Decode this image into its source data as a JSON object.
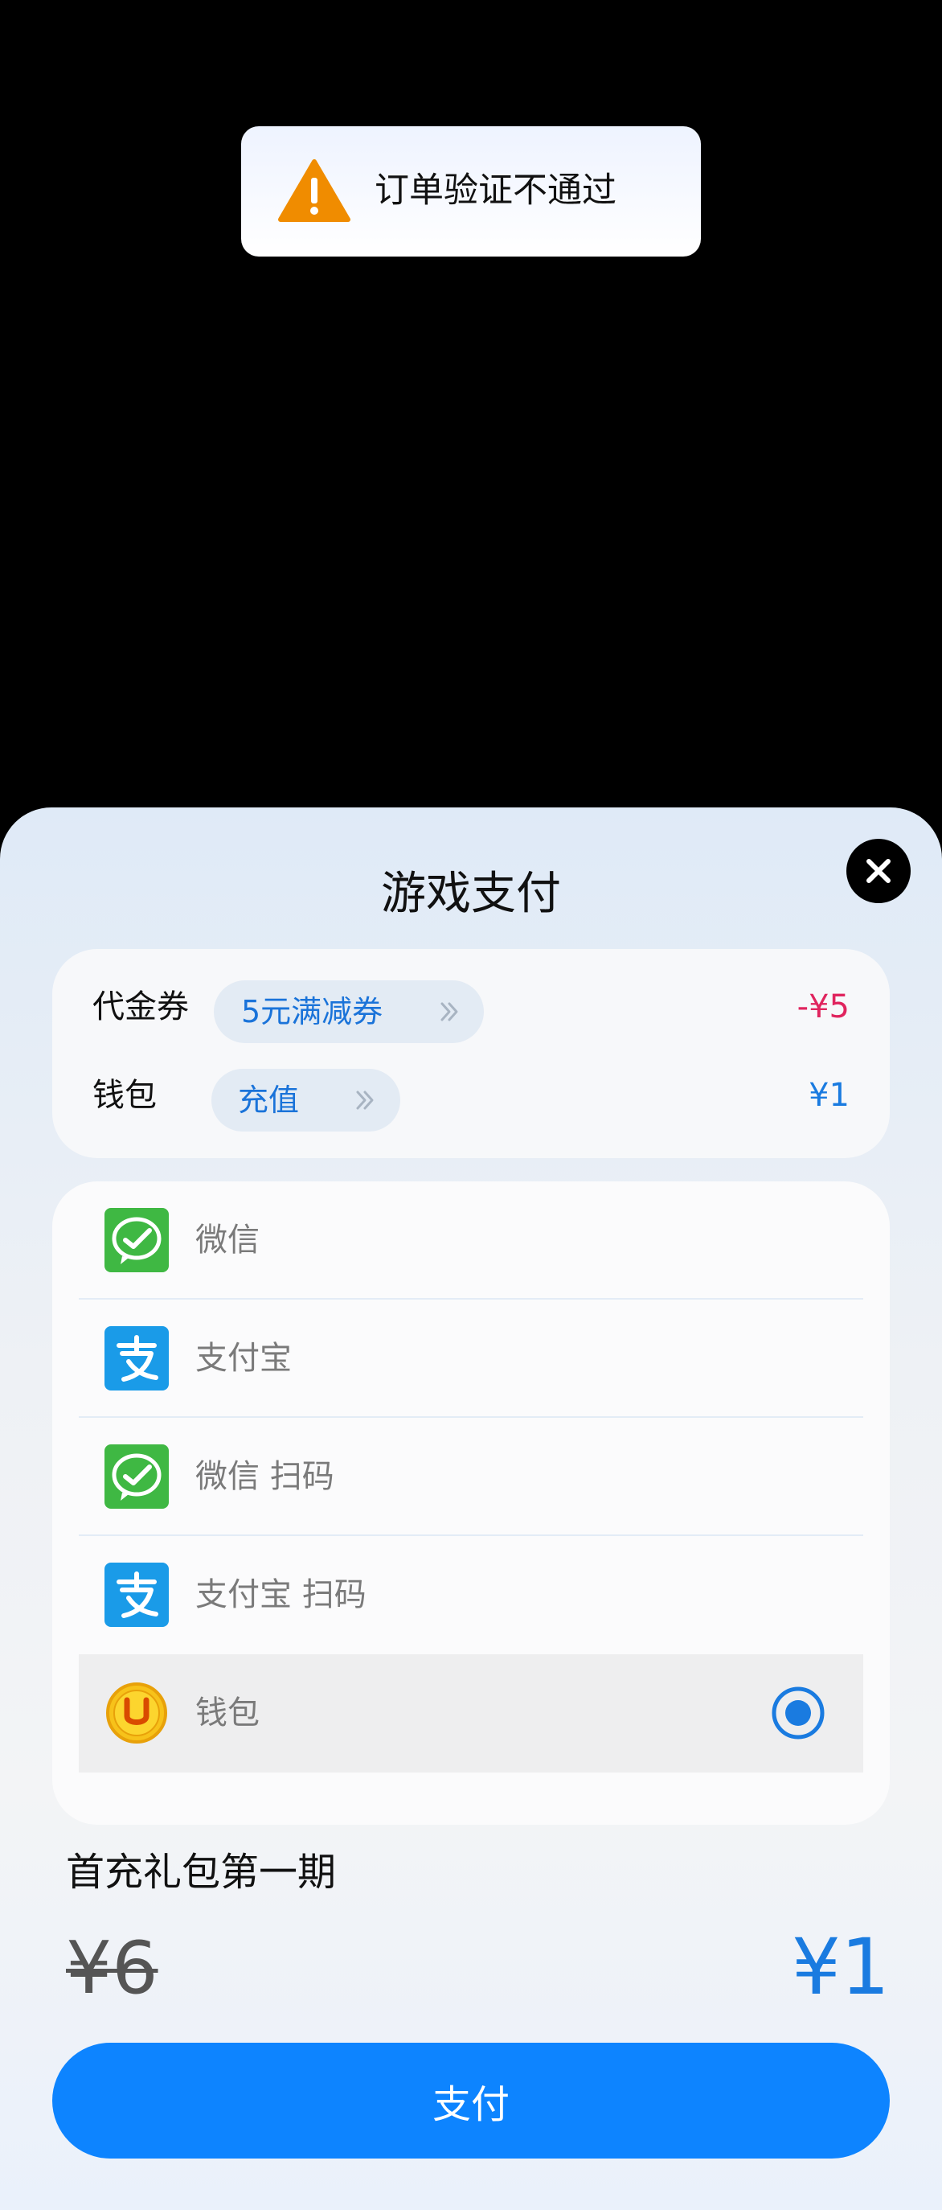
{
  "toast": {
    "icon": "warning-triangle-icon",
    "text": "订单验证不通过",
    "accent": "#f08c00"
  },
  "sheet": {
    "title": "游戏支付",
    "close_icon": "close-icon"
  },
  "discounts": {
    "voucher": {
      "label": "代金券",
      "pill_text": "5元满减券",
      "value": "-¥5",
      "value_color": "#e0245e"
    },
    "wallet": {
      "label": "钱包",
      "pill_text": "充值",
      "value": "¥1",
      "value_color": "#1a7be0"
    }
  },
  "payment_methods": [
    {
      "label": "微信",
      "icon": "wechat-icon",
      "selected": false
    },
    {
      "label": "支付宝",
      "icon": "alipay-icon",
      "selected": false
    },
    {
      "label": "微信 扫码",
      "icon": "wechat-icon",
      "selected": false
    },
    {
      "label": "支付宝 扫码",
      "icon": "alipay-icon",
      "selected": false
    },
    {
      "label": "钱包",
      "icon": "wallet-coin-icon",
      "selected": true
    }
  ],
  "product": {
    "name": "首充礼包第一期",
    "original_price": "¥6",
    "final_price": "¥1"
  },
  "pay_button": {
    "label": "支付",
    "color": "#0d84ff"
  }
}
